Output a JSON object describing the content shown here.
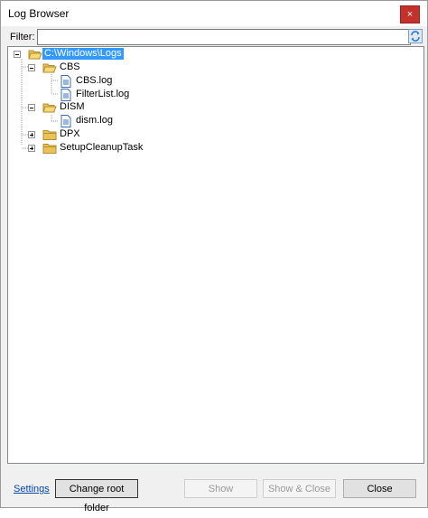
{
  "window": {
    "title": "Log Browser",
    "close_glyph": "×"
  },
  "filter": {
    "label": "Filter:",
    "value": "",
    "placeholder": ""
  },
  "tree": {
    "root": {
      "label": "C:\\Windows\\Logs"
    },
    "cbs": {
      "label": "CBS"
    },
    "cbs_log": {
      "label": "CBS.log"
    },
    "filterlist_log": {
      "label": "FilterList.log"
    },
    "dism": {
      "label": "DISM"
    },
    "dism_log": {
      "label": "dism.log"
    },
    "dpx": {
      "label": "DPX"
    },
    "setup": {
      "label": "SetupCleanupTask"
    }
  },
  "footer": {
    "settings_link": "Settings",
    "change_root": "Change root folder",
    "show": "Show",
    "show_close": "Show & Close",
    "close": "Close"
  },
  "colors": {
    "selection": "#3399ff",
    "close_button": "#c4302b",
    "link": "#0645ad",
    "folder": "#e9c25a"
  },
  "icons": {
    "refresh": "refresh-icon",
    "folder_open": "folder-open-icon",
    "folder_closed": "folder-closed-icon",
    "file": "log-file-icon"
  }
}
